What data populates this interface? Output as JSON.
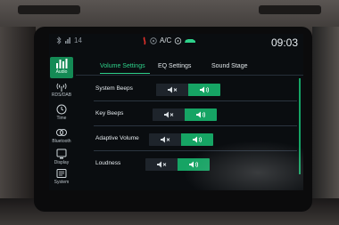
{
  "status_bar": {
    "indicator": "14",
    "ac_label": "A/C",
    "time": "09:03",
    "accent": "#2ed18a",
    "icons": [
      "bluetooth-icon",
      "signal-icon",
      "seat-heat-icon",
      "fan-icon",
      "steering-heat-icon",
      "car-icon"
    ]
  },
  "sidebar": {
    "items": [
      {
        "label": "Audio",
        "icon": "audio-bars-icon",
        "active": true
      },
      {
        "label": "RDS/DAB",
        "icon": "radio-icon",
        "active": false
      },
      {
        "label": "Time",
        "icon": "clock-icon",
        "active": false
      },
      {
        "label": "Bluetooth",
        "icon": "bluetooth-phone-icon",
        "active": false
      },
      {
        "label": "Display",
        "icon": "display-icon",
        "active": false
      },
      {
        "label": "System",
        "icon": "system-icon",
        "active": false
      }
    ]
  },
  "tabs": [
    {
      "label": "Volume Settings",
      "active": true
    },
    {
      "label": "EQ Settings",
      "active": false
    },
    {
      "label": "Sound Stage",
      "active": false
    }
  ],
  "settings": [
    {
      "label": "System Beeps",
      "selected": "on"
    },
    {
      "label": "Key Beeps",
      "selected": "on"
    },
    {
      "label": "Adaptive Volume",
      "selected": "on"
    },
    {
      "label": "Loudness",
      "selected": "on"
    }
  ],
  "colors": {
    "active": "#16a464",
    "background": "#0a0d10",
    "text": "#e4eaee"
  }
}
